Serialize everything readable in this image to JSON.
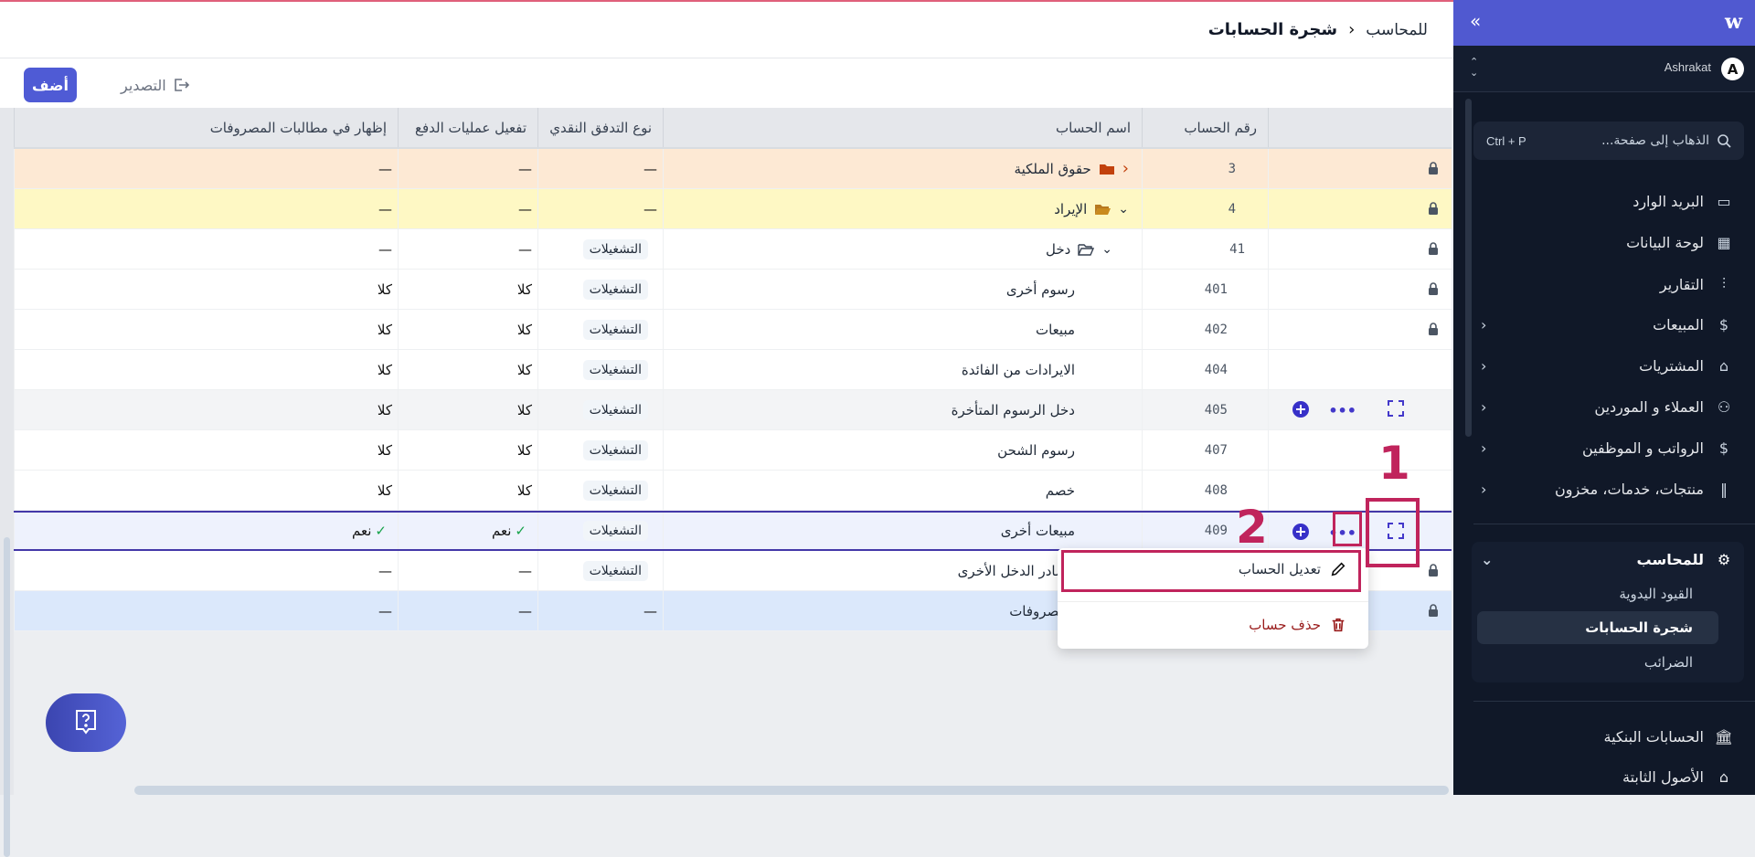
{
  "header": {
    "breadcrumb_parent": "للمحاسب",
    "breadcrumb_current": "شجرة الحسابات"
  },
  "toolbar": {
    "add_label": "أضف",
    "export_label": "التصدير"
  },
  "table": {
    "columns": [
      "",
      "رقم الحساب",
      "اسم الحساب",
      "نوع التدفق النقدي",
      "تفعيل عمليات الدفع",
      "إظهار في مطالبات المصروفات"
    ],
    "rows": [
      {
        "number": "3",
        "name": "حقوق الملكية",
        "cash_flow": "—",
        "payments": "—",
        "expense_claims": "—",
        "locked": true,
        "style": "orange",
        "tree": "collapsed",
        "folder": "filled"
      },
      {
        "number": "4",
        "name": "الإيراد",
        "cash_flow": "—",
        "payments": "—",
        "expense_claims": "—",
        "locked": true,
        "style": "yellow",
        "tree": "expanded",
        "folder": "open"
      },
      {
        "number": "41",
        "name": "دخل",
        "cash_flow": "التشغيلات",
        "payments": "—",
        "expense_claims": "—",
        "locked": true,
        "style": "",
        "tree": "expanded",
        "folder": "outline"
      },
      {
        "number": "401",
        "name": "رسوم أخرى",
        "cash_flow": "التشغيلات",
        "payments": "كلا",
        "expense_claims": "كلا",
        "locked": true,
        "style": ""
      },
      {
        "number": "402",
        "name": "مبيعات",
        "cash_flow": "التشغيلات",
        "payments": "كلا",
        "expense_claims": "كلا",
        "locked": true,
        "style": ""
      },
      {
        "number": "404",
        "name": "الايرادات من الفائدة",
        "cash_flow": "التشغيلات",
        "payments": "كلا",
        "expense_claims": "كلا",
        "locked": false,
        "style": ""
      },
      {
        "number": "405",
        "name": "دخل الرسوم المتأخرة",
        "cash_flow": "التشغيلات",
        "payments": "كلا",
        "expense_claims": "كلا",
        "locked": false,
        "style": "hover",
        "actions": true
      },
      {
        "number": "407",
        "name": "رسوم الشحن",
        "cash_flow": "التشغيلات",
        "payments": "كلا",
        "expense_claims": "كلا",
        "locked": false,
        "style": ""
      },
      {
        "number": "408",
        "name": "خصم",
        "cash_flow": "التشغيلات",
        "payments": "كلا",
        "expense_claims": "كلا",
        "locked": false,
        "style": ""
      },
      {
        "number": "409",
        "name": "مبيعات أخرى",
        "cash_flow": "التشغيلات",
        "payments": "نعم",
        "expense_claims": "نعم",
        "locked": false,
        "style": "selected",
        "actions": true,
        "check": true
      },
      {
        "number": "",
        "name": "مصادر الدخل الأخرى",
        "cash_flow": "التشغيلات",
        "payments": "—",
        "expense_claims": "—",
        "locked": true,
        "style": ""
      },
      {
        "number": "",
        "name": "المصروفات",
        "cash_flow": "—",
        "payments": "—",
        "expense_claims": "—",
        "locked": true,
        "style": "blue"
      }
    ]
  },
  "context_menu": {
    "edit_label": "تعديل الحساب",
    "delete_label": "حذف حساب"
  },
  "annotations": {
    "one": "1",
    "two": "2"
  },
  "sidebar": {
    "user": {
      "initial": "A",
      "name": "Ashrakat"
    },
    "search": {
      "placeholder": "الذهاب إلى صفحة...",
      "shortcut": "Ctrl + P"
    },
    "items": [
      {
        "label": "البريد الوارد",
        "icon": "inbox-icon"
      },
      {
        "label": "لوحة البيانات",
        "icon": "dashboard-icon"
      },
      {
        "label": "التقارير",
        "icon": "bar-chart-icon"
      },
      {
        "label": "المبيعات",
        "icon": "dollar-icon",
        "chevron": true
      },
      {
        "label": "المشتريات",
        "icon": "bag-icon",
        "chevron": true
      },
      {
        "label": "العملاء و الموردين",
        "icon": "users-icon",
        "chevron": true
      },
      {
        "label": "الرواتب و الموظفين",
        "icon": "payroll-icon",
        "chevron": true
      },
      {
        "label": "منتجات، خدمات، مخزون",
        "icon": "barcode-icon",
        "chevron": true
      }
    ],
    "group": {
      "label": "للمحاسب",
      "subitems": [
        "القيود اليدوية",
        "شجرة الحسابات",
        "الضرائب"
      ]
    },
    "bottom_items": [
      {
        "label": "الحسابات البنكية",
        "icon": "bank-icon"
      },
      {
        "label": "الأصول الثابتة",
        "icon": "building-icon"
      }
    ]
  },
  "colors": {
    "accent": "#4f5bd5",
    "annotation": "#c0245c",
    "sidebar_bg": "#101828"
  }
}
